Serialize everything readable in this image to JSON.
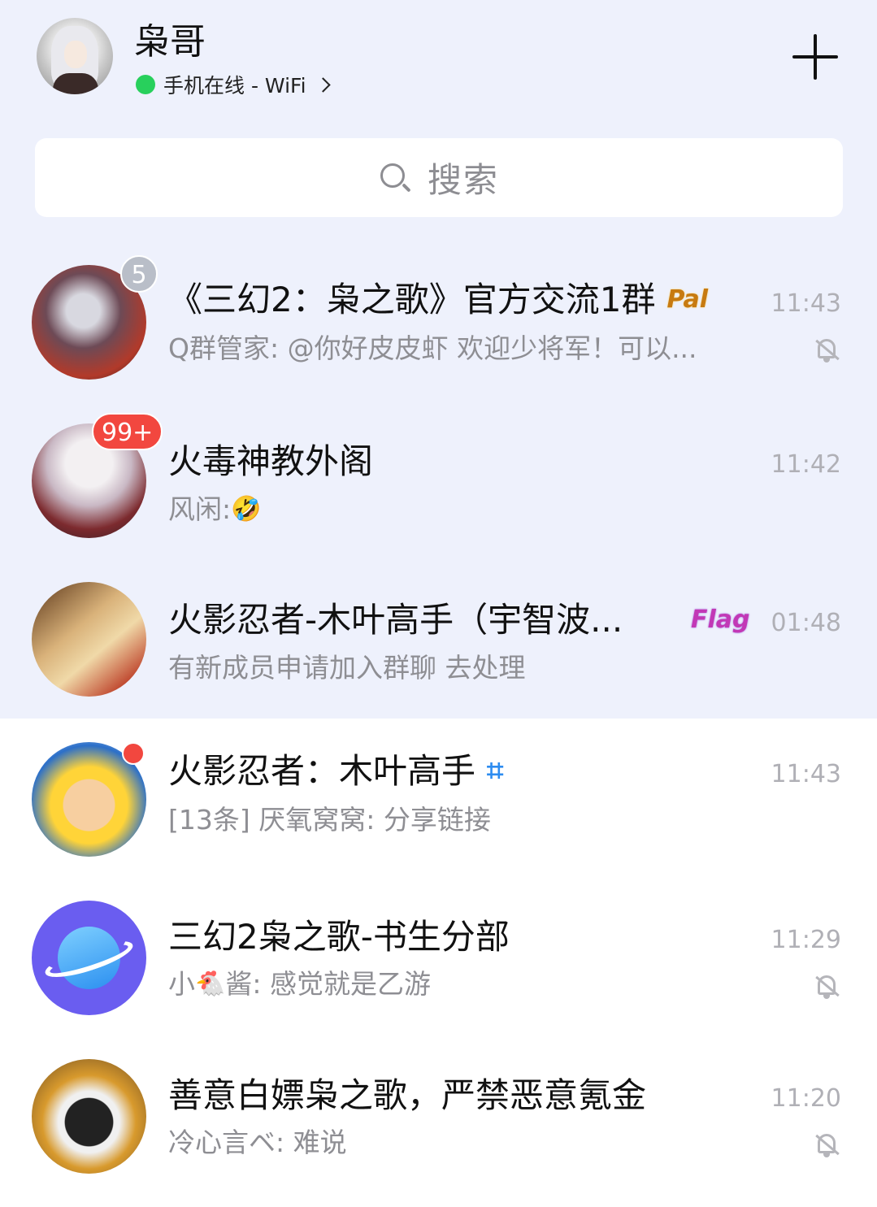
{
  "header": {
    "user_name": "枭哥",
    "status_text": "手机在线 - WiFi",
    "status_color": "#28d05c"
  },
  "search": {
    "placeholder": "搜索"
  },
  "chats": [
    {
      "title": "《三幻2：枭之歌》官方交流1群",
      "tag": "Pal",
      "preview": "Q群管家: @你好皮皮虾 欢迎少将军！可以...",
      "time": "11:43",
      "badge": "5",
      "muted": true
    },
    {
      "title": "火毒神教外阁",
      "preview": "风闲:",
      "preview_emoji": "🤣",
      "time": "11:42",
      "badge": "99+",
      "muted": false
    },
    {
      "title": "火影忍者-木叶高手（宇智波...",
      "tag": "Flag",
      "preview": "有新成员申请加入群聊 去处理",
      "time": "01:48",
      "muted": false
    },
    {
      "title": "火影忍者：木叶高手",
      "preview": "[13条] 厌氧窝窝: 分享链接",
      "time": "11:43",
      "unread_dot": true,
      "muted": false
    },
    {
      "title": "三幻2枭之歌-书生分部",
      "preview_prefix": "小",
      "preview_emoji": "🐔",
      "preview": "酱: 感觉就是乙游",
      "time": "11:29",
      "muted": true
    },
    {
      "title": "善意白嫖枭之歌，严禁恶意氪金",
      "preview": "冷心言ベ: 难说",
      "time": "11:20",
      "muted": true
    }
  ],
  "colors": {
    "pinned_background": "#eef1fc",
    "badge_red": "#f2473f",
    "badge_grey": "#b9bec8",
    "hash_blue": "#2d8cf0"
  }
}
